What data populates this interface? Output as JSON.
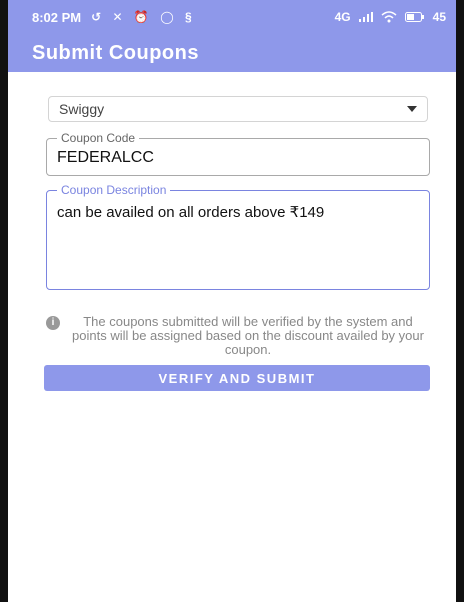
{
  "status_bar": {
    "time": "8:02 PM",
    "left_icons": "↺ ✕ ⏰ ◯ §",
    "network": "4G",
    "battery": "45"
  },
  "app_bar": {
    "title": "Submit Coupons"
  },
  "form": {
    "store": {
      "selected": "Swiggy"
    },
    "coupon_code": {
      "label": "Coupon Code",
      "value": "FEDERALCC"
    },
    "coupon_description": {
      "label": "Coupon Description",
      "value": "can be availed on all orders above ₹149"
    }
  },
  "info": {
    "icon": "i",
    "text": "The coupons submitted will be verified by the system and points will be assigned based on the discount availed by your coupon."
  },
  "submit": {
    "label": "VERIFY AND SUBMIT"
  },
  "colors": {
    "primary": "#8e98ea",
    "focus": "#7a84e0"
  }
}
